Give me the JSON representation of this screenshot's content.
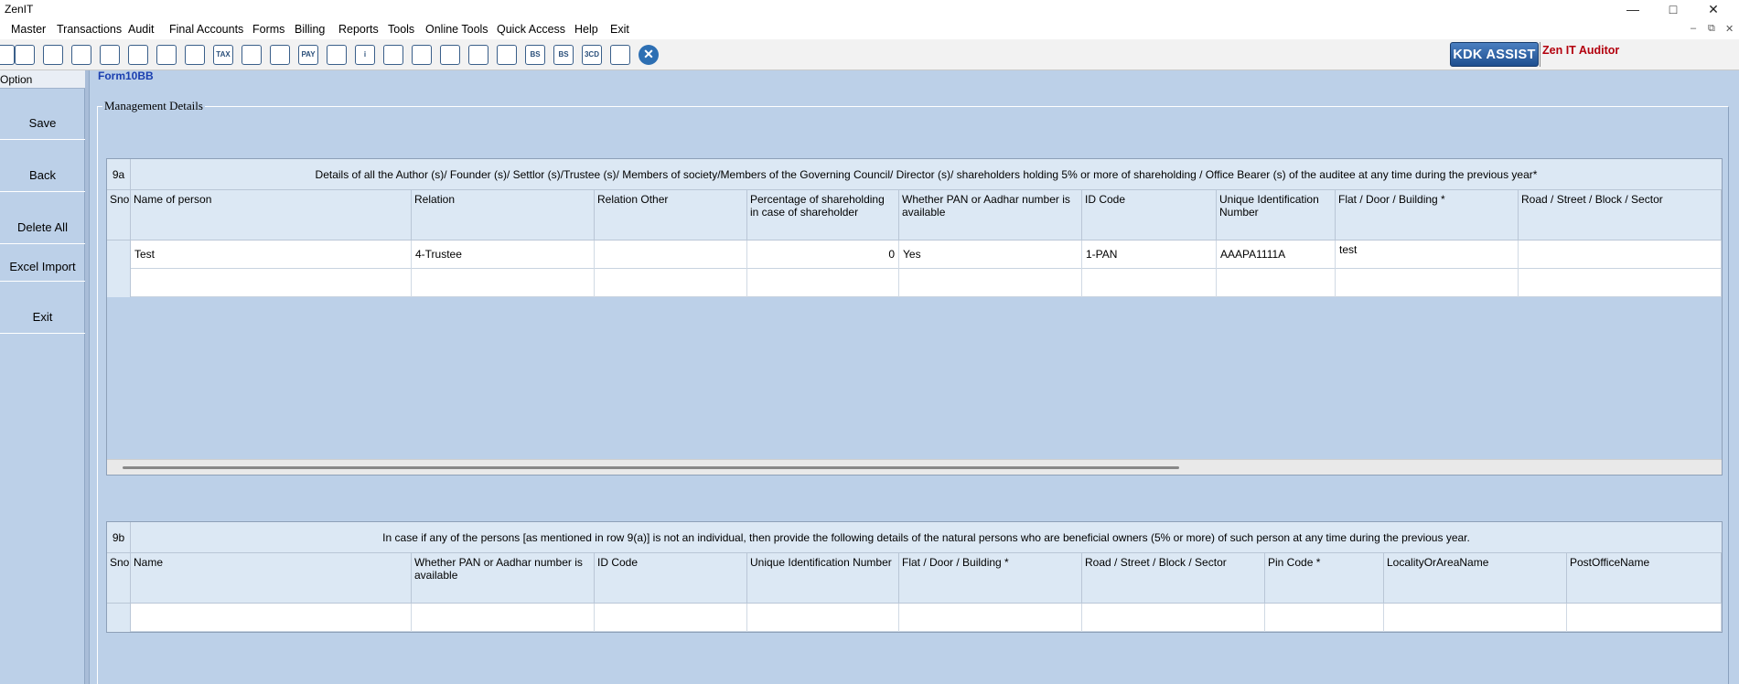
{
  "window": {
    "title": "ZenIT",
    "minimize": "—",
    "maximize": "□",
    "close": "✕"
  },
  "menu": [
    "Master",
    "Transactions",
    "Audit",
    "Final Accounts",
    "Forms",
    "Billing",
    "Reports",
    "Tools",
    "Online Tools",
    "Quick Access",
    "Help",
    "Exit"
  ],
  "mdi_controls": [
    "–",
    "⧉",
    "✕"
  ],
  "toolbar": {
    "icons": [
      "document-icon",
      "home-icon",
      "bar-chart-icon",
      "building-icon",
      "gift-icon",
      "people-icon",
      "gavel-icon",
      "filter-icon",
      "tax-icon",
      "calculator-icon",
      "pie-chart-icon",
      "pay-icon",
      "book-icon",
      "info-icon",
      "report-icon",
      "user-doc-icon",
      "calendar-icon",
      "add-folder-icon",
      "refresh-icon",
      "balance-sheet-icon",
      "bs-report-icon",
      "3cd-icon",
      "grid-report-icon"
    ],
    "icon_labels": [
      "",
      "",
      "",
      "",
      "",
      "",
      "",
      "",
      "TAX",
      "",
      "",
      "PAY",
      "",
      "i",
      "",
      "",
      "",
      "",
      "",
      "BS",
      "BS",
      "3CD",
      ""
    ],
    "close_label": "✕",
    "kdk_assist": "KDK ASSIST",
    "brand": "Zen IT Auditor"
  },
  "left_panel": {
    "header": "Option",
    "buttons": [
      "Save",
      "Back",
      "Delete All",
      "Excel Import",
      "Exit"
    ]
  },
  "form": {
    "title": "Form10BB",
    "group_label": "Management Details"
  },
  "grid_9a": {
    "number": "9a",
    "caption": "Details of all the Author (s)/ Founder (s)/ Settlor (s)/Trustee (s)/ Members of society/Members of the Governing Council/ Director (s)/ shareholders holding 5% or more of shareholding / Office Bearer (s) of the auditee at any time during the previous year*",
    "columns": [
      "Sno",
      "Name of person",
      "Relation",
      "Relation Other",
      "Percentage of shareholding in case of shareholder",
      "Whether PAN or Aadhar number is available",
      "ID Code",
      "Unique Identification Number",
      "Flat / Door / Building *",
      "Road / Street / Block / Sector"
    ],
    "rows": [
      [
        "",
        "Test",
        "4-Trustee",
        "",
        "0",
        "Yes",
        "1-PAN",
        "AAAPA1111A",
        "test",
        ""
      ],
      [
        "",
        "",
        "",
        "",
        "",
        "",
        "",
        "",
        "",
        ""
      ]
    ]
  },
  "grid_9b": {
    "number": "9b",
    "caption": "In case if any of the persons [as mentioned in row 9(a)] is not an individual, then provide the following details of the natural persons who are beneficial owners (5% or more) of such person at any time during the previous year.",
    "columns": [
      "Sno",
      "Name",
      "Whether PAN or Aadhar number is available",
      "ID Code",
      "Unique Identification Number",
      "Flat / Door / Building *",
      "Road / Street / Block / Sector",
      "Pin Code *",
      "LocalityOrAreaName",
      "PostOfficeName"
    ],
    "rows": [
      [
        "",
        "",
        "",
        "",
        "",
        "",
        "",
        "",
        "",
        ""
      ]
    ]
  },
  "colors": {
    "background": "#bcd0e8",
    "header_cell": "#dce8f4",
    "accent_blue": "#1a3fb0",
    "brand_red": "#b3000d"
  }
}
